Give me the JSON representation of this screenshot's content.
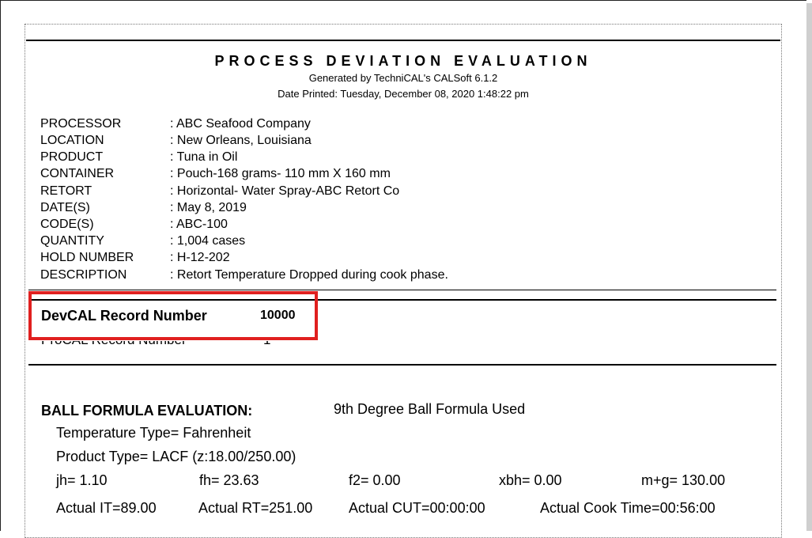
{
  "header": {
    "title": "PROCESS DEVIATION EVALUATION",
    "generated_by": "Generated by TechniCAL's CALSoft 6.1.2",
    "date_printed": "Date Printed: Tuesday, December 08, 2020   1:48:22 pm"
  },
  "details": [
    {
      "label": "PROCESSOR",
      "value": ": ABC Seafood Company"
    },
    {
      "label": "LOCATION",
      "value": ": New Orleans, Louisiana"
    },
    {
      "label": "PRODUCT",
      "value": ": Tuna in Oil"
    },
    {
      "label": "CONTAINER",
      "value": ": Pouch-168 grams- 110 mm X 160 mm"
    },
    {
      "label": "RETORT",
      "value": ": Horizontal- Water Spray-ABC Retort Co"
    },
    {
      "label": "DATE(S)",
      "value": ": May 8, 2019"
    },
    {
      "label": "CODE(S)",
      "value": ": ABC-100"
    },
    {
      "label": "QUANTITY",
      "value": ": 1,004 cases"
    },
    {
      "label": "HOLD NUMBER",
      "value": ": H-12-202"
    },
    {
      "label": "DESCRIPTION",
      "value": ": Retort Temperature Dropped during cook phase."
    }
  ],
  "records": {
    "devcal_label": "DevCAL Record Number",
    "devcal_value": "10000",
    "procal_label": "ProCAL Record Number",
    "procal_value": "1"
  },
  "ball": {
    "heading": "BALL FORMULA EVALUATION:",
    "formula": "9th Degree Ball Formula Used",
    "temperature_type": "Temperature Type= Fahrenheit",
    "product_type": "Product Type= LACF (z:18.00/250.00)",
    "jh": "jh= 1.10",
    "fh": "fh= 23.63",
    "f2": "f2= 0.00",
    "xbh": "xbh= 0.00",
    "mg": "m+g= 130.00",
    "actual_it": "Actual IT=89.00",
    "actual_rt": "Actual RT=251.00",
    "actual_cut": "Actual CUT=00:00:00",
    "actual_cook_time": "Actual Cook Time=00:56:00"
  },
  "annotation": {
    "highlight_color": "#e0201f"
  }
}
